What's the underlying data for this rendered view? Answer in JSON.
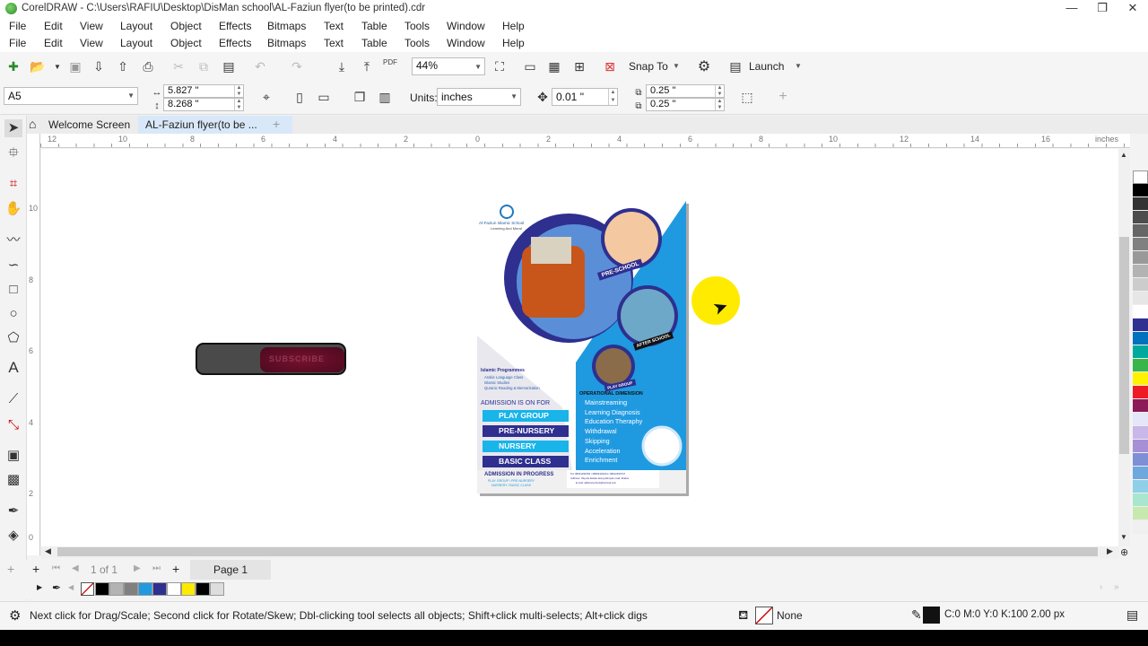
{
  "window": {
    "title": "CorelDRAW - C:\\Users\\RAFIU\\Desktop\\DisMan school\\AL-Faziun flyer(to be printed).cdr",
    "buttons": [
      "—",
      "❐",
      "✕"
    ]
  },
  "menu": [
    "File",
    "Edit",
    "View",
    "Layout",
    "Object",
    "Effects",
    "Bitmaps",
    "Text",
    "Table",
    "Tools",
    "Window",
    "Help"
  ],
  "toolbar": {
    "zoom": "44%",
    "snap_to": "Snap To",
    "launch": "Launch",
    "pdf": "PDF"
  },
  "property_bar": {
    "page_size": "A5",
    "width": "5.827 \"",
    "height": "8.268 \"",
    "units_label": "Units:",
    "units_value": "inches",
    "nudge": "0.01 \"",
    "dup_x": "0.25 \"",
    "dup_y": "0.25 \""
  },
  "tabs": {
    "welcome": "Welcome Screen",
    "document": "AL-Faziun flyer(to be ...",
    "add": "+"
  },
  "ruler": {
    "h_labels": [
      "12",
      "10",
      "8",
      "6",
      "4",
      "2",
      "0",
      "2",
      "4",
      "6",
      "8",
      "10",
      "12",
      "14",
      "16"
    ],
    "units": "inches",
    "v_labels": [
      "10",
      "8",
      "6",
      "4",
      "2",
      "0"
    ]
  },
  "canvas": {
    "subscribe_text": "SUBSCRIBE"
  },
  "flyer": {
    "school_name": "Al-Faziun Islamic School",
    "motto": "Learning And Moral",
    "badge_preschool": "PRE-SCHOOL",
    "badge_afterschool": "AFTER SCHOOL",
    "badge_playgroup": "PLAY GROUP",
    "islamic_heading": "Islamic Programmes",
    "islamic_items": [
      "Arabic Language Class",
      "Islamic Studies",
      "Quranic Reading & Memorization"
    ],
    "admission_heading": "ADMISSION IS ON FOR",
    "admission_items": [
      "PLAY GROUP",
      "PRE-NURSERY",
      "NURSERY",
      "BASIC CLASS"
    ],
    "operational_heading": "OPERATIONAL DIMENSION",
    "operational_items": [
      "Mainstreaming",
      "Learning Diagnosis",
      "Education Theraphy",
      "Withdrawal",
      "Skipping",
      "Acceleration",
      "Enrichment"
    ],
    "progress_heading": "ADMISSION IN PROGRESS",
    "progress_line1": "PLAY GROUP / PRE-NURSERY",
    "progress_line2": "NURSERY / BASIC CLASS",
    "contact_tel": "Tel: 08031299752 / 08064432224 / 08102290747",
    "contact_address": "Address: Oluyole Estate along Akinyele road, Ibadan",
    "contact_email": "E-mail: alfaziunschool@hotmail.com"
  },
  "page_nav": {
    "count": "1 of 1",
    "page_tab": "Page 1"
  },
  "status": {
    "hint": "Next click for Drag/Scale; Second click for Rotate/Skew; Dbl-clicking tool selects all objects; Shift+click multi-selects; Alt+click digs",
    "fill": "None",
    "outline": "C:0 M:0 Y:0 K:100  2.00 px"
  },
  "colors": {
    "flyer_blue": "#1f9ae0",
    "flyer_navy": "#2e2f8f",
    "flyer_cyan": "#18b4ea",
    "highlight": "#ffeb00"
  },
  "palette": [
    "#ffffff",
    "#000000",
    "#333333",
    "#4d4d4d",
    "#666666",
    "#808080",
    "#999999",
    "#b3b3b3",
    "#cccccc",
    "#e6e6e6",
    "#ffffff",
    "#2e3192",
    "#0071bc",
    "#00a99d",
    "#39b54a",
    "#fff200",
    "#ed1c24",
    "#8c1a59",
    "#e6e6fa",
    "#c8b7e8",
    "#a68fd5",
    "#7f8fd6",
    "#6fa8dc",
    "#8fd0e8",
    "#a8e6cf",
    "#c7e9b0",
    "#f0f0f0"
  ],
  "doc_palette": [
    "#000000",
    "#b3b3b3",
    "#808080",
    "#1f9ae0",
    "#2e2f8f",
    "#ffffff",
    "#ffeb00",
    "#000000",
    "#dddddd"
  ]
}
